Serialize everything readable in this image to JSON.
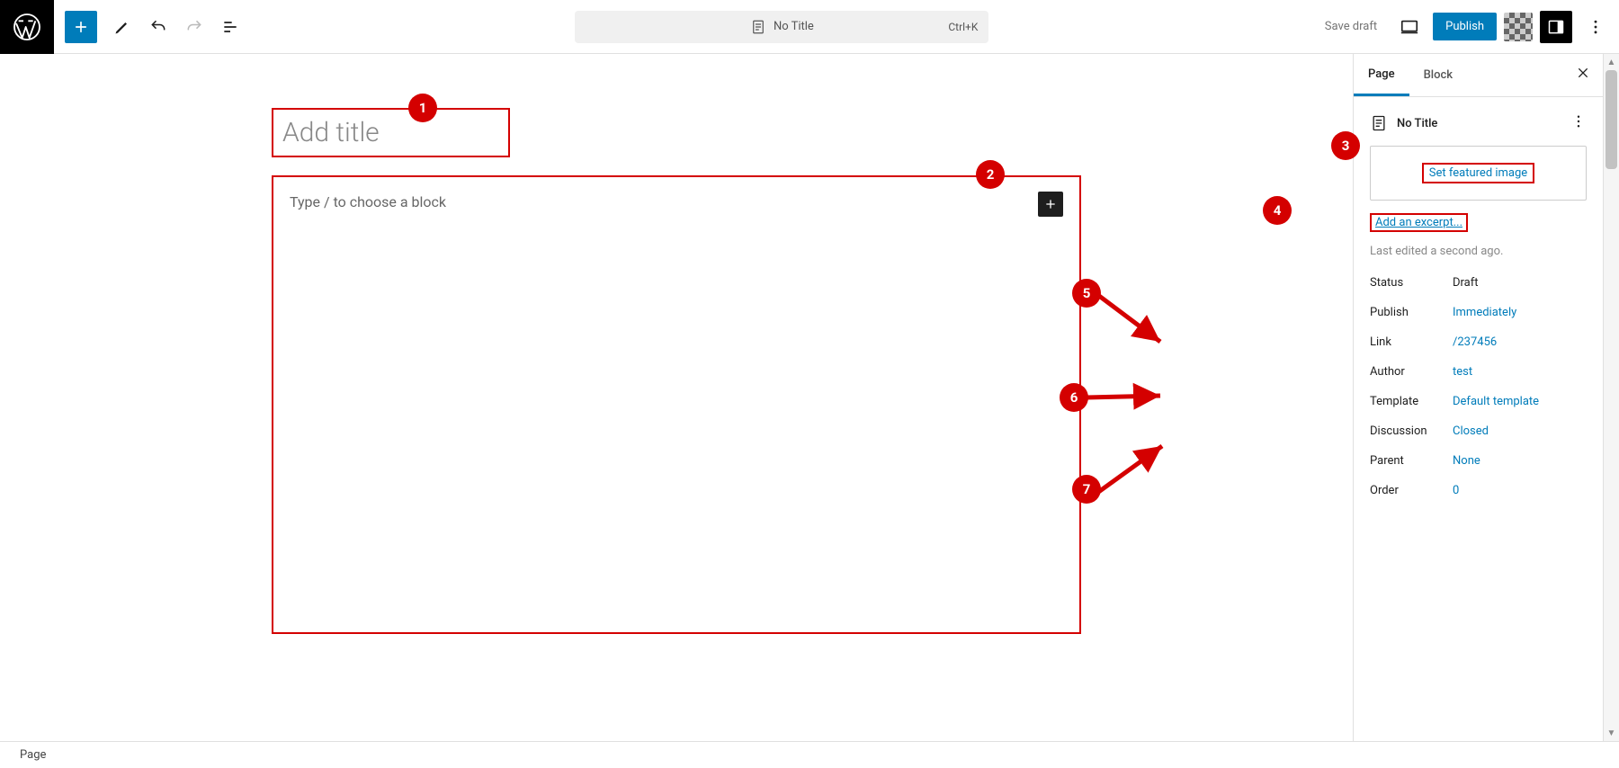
{
  "topbar": {
    "document_title": "No Title",
    "shortcut": "Ctrl+K",
    "save_draft": "Save draft",
    "publish": "Publish"
  },
  "editor": {
    "title_placeholder": "Add title",
    "content_placeholder": "Type / to choose a block"
  },
  "sidebar": {
    "tabs": {
      "page": "Page",
      "block": "Block"
    },
    "doc_title": "No Title",
    "featured_image_label": "Set featured image",
    "excerpt_label": "Add an excerpt...",
    "last_edited": "Last edited a second ago.",
    "rows": [
      {
        "label": "Status",
        "value": "Draft",
        "plain": true
      },
      {
        "label": "Publish",
        "value": "Immediately",
        "plain": false
      },
      {
        "label": "Link",
        "value": "/237456",
        "plain": false
      },
      {
        "label": "Author",
        "value": "test",
        "plain": false
      },
      {
        "label": "Template",
        "value": "Default template",
        "plain": false
      },
      {
        "label": "Discussion",
        "value": "Closed",
        "plain": false
      },
      {
        "label": "Parent",
        "value": "None",
        "plain": false
      },
      {
        "label": "Order",
        "value": "0",
        "plain": false
      }
    ]
  },
  "footer": {
    "breadcrumb": "Page"
  },
  "annotations": [
    "1",
    "2",
    "3",
    "4",
    "5",
    "6",
    "7"
  ]
}
